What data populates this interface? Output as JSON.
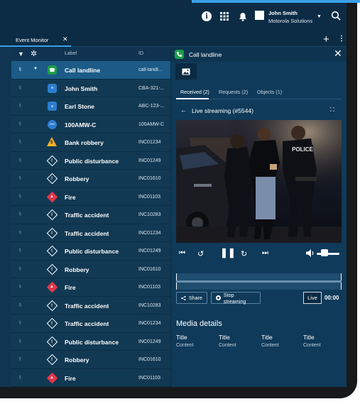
{
  "topbar": {
    "user_name": "John Smith",
    "user_org": "Motorola Solutions",
    "icons": [
      "info-icon",
      "grid-icon",
      "bell-icon",
      "search-icon"
    ]
  },
  "tabs": {
    "event_monitor": "Event Monitor"
  },
  "list": {
    "col_label": "Label",
    "col_id": "ID",
    "rows": [
      {
        "label": "Call landline",
        "id": "call-landl...",
        "icon": "phone-icon",
        "selected": true
      },
      {
        "label": "John Smith",
        "id": "CBA-321-...",
        "icon": "person-icon"
      },
      {
        "label": "Earl Stone",
        "id": "ABC-123-...",
        "icon": "person-icon"
      },
      {
        "label": "100AMW-C",
        "id": "100AMW-C",
        "icon": "unit-icon"
      },
      {
        "label": "Bank robbery",
        "id": "INC01234",
        "icon": "warning-icon"
      },
      {
        "label": "Public disturbance",
        "id": "INC01249",
        "icon": "incident-icon"
      },
      {
        "label": "Robbery",
        "id": "INC01610",
        "icon": "incident-icon"
      },
      {
        "label": "Fire",
        "id": "INC01103",
        "icon": "fire-icon"
      },
      {
        "label": "Traffic accident",
        "id": "INC10283",
        "icon": "incident-icon"
      },
      {
        "label": "Traffic accident",
        "id": "INC01234",
        "icon": "incident-icon"
      },
      {
        "label": "Public disturbance",
        "id": "INC01249",
        "icon": "incident-icon"
      },
      {
        "label": "Robbery",
        "id": "INC01610",
        "icon": "incident-icon"
      },
      {
        "label": "Fire",
        "id": "INC01103",
        "icon": "fire-icon"
      },
      {
        "label": "Traffic accident",
        "id": "INC10283",
        "icon": "incident-icon"
      },
      {
        "label": "Traffic accident",
        "id": "INC01234",
        "icon": "incident-icon"
      },
      {
        "label": "Public disturbance",
        "id": "INC01249",
        "icon": "incident-icon"
      },
      {
        "label": "Robbery",
        "id": "INC01610",
        "icon": "incident-icon"
      },
      {
        "label": "Fire",
        "id": "INC01103",
        "icon": "fire-icon"
      }
    ]
  },
  "detail": {
    "title": "Call landline",
    "subtabs": [
      "Received (2)",
      "Requests (2)",
      "Objects (1)"
    ],
    "stream_title": "Live streaming (#5544)",
    "video_text": "POLICE",
    "share_label": "Share",
    "stop_label": "Stop streaming",
    "live_label": "Live",
    "time": "00:00",
    "volume": 0.35,
    "media_details_title": "Media details",
    "media_details": [
      {
        "key": "Title",
        "value": "Content"
      },
      {
        "key": "Title",
        "value": "Content"
      },
      {
        "key": "Title",
        "value": "Content"
      },
      {
        "key": "Title",
        "value": "Content"
      }
    ]
  },
  "colors": {
    "background": "#0f3553",
    "selected_row": "#1c5b87",
    "accent": "#3aa0e8",
    "phone": "#1a9e47",
    "person": "#2c7fd0",
    "warning": "#f5b327",
    "fire": "#e4364a"
  }
}
